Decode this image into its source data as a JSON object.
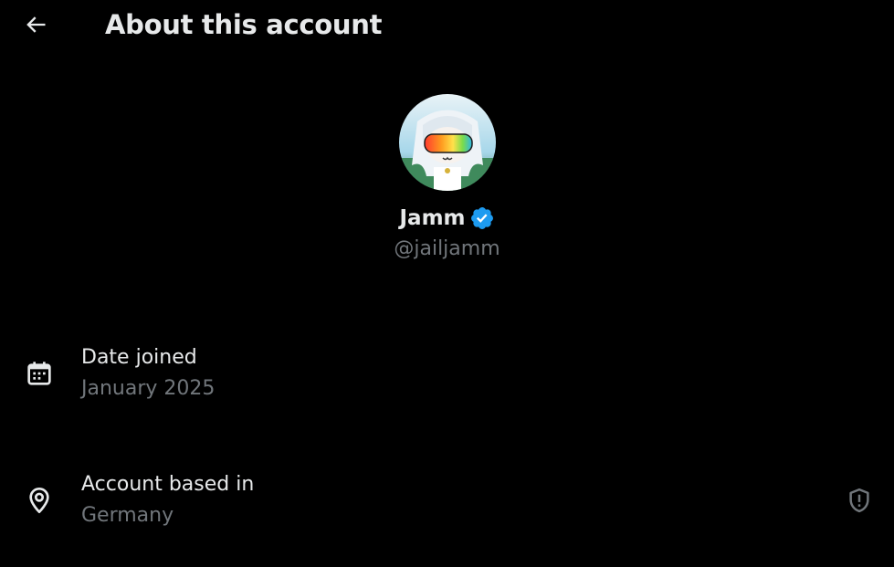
{
  "header": {
    "title": "About this account",
    "back_icon": "arrow-left-icon"
  },
  "profile": {
    "display_name": "Jamm",
    "handle": "@jailjamm",
    "verified": true,
    "verified_color": "#1d9bf0",
    "avatar_icon": "avatar-image"
  },
  "details": [
    {
      "icon": "calendar-icon",
      "label": "Date joined",
      "value": "January 2025"
    },
    {
      "icon": "location-pin-icon",
      "label": "Account based in",
      "value": "Germany",
      "action_icon": "shield-alert-icon"
    }
  ],
  "colors": {
    "background": "#000000",
    "primary_text": "#e7e9ea",
    "secondary_text": "#71767b"
  }
}
